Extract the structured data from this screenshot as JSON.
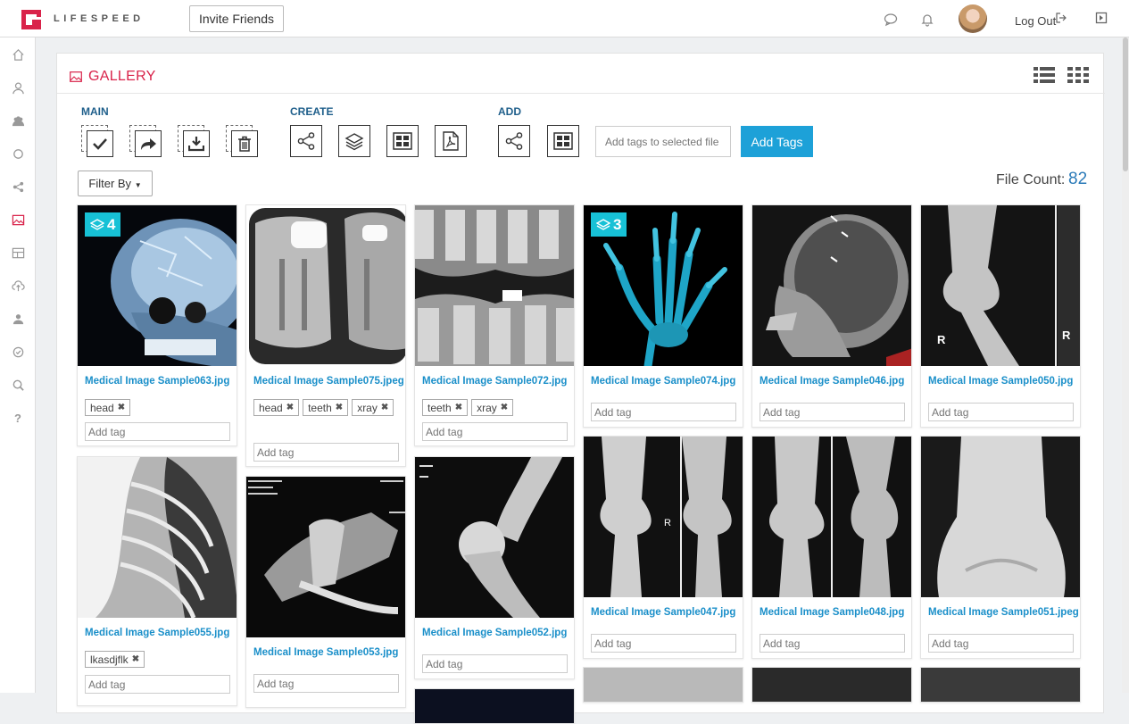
{
  "app": {
    "brand": "LIFESPEED",
    "invite_label": "Invite Friends",
    "logout_label": "Log Out",
    "accent_color": "#d9234a",
    "link_color": "#1a8fc9"
  },
  "gallery": {
    "title": "GALLERY",
    "sections": {
      "main": "MAIN",
      "create": "CREATE",
      "add": "ADD"
    },
    "tag_input_placeholder": "Add tags to selected file",
    "add_tags_label": "Add Tags",
    "filter_label": "Filter By",
    "file_count_label": "File Count:",
    "file_count": "82",
    "add_tag_placeholder": "Add tag"
  },
  "cards": [
    {
      "name": "Medical Image Sample063.jpg",
      "badge": "4",
      "tags": [
        "head"
      ]
    },
    {
      "name": "Medical Image Sample075.jpeg",
      "badge": "",
      "tags": [
        "head",
        "teeth",
        "xray"
      ]
    },
    {
      "name": "Medical Image Sample072.jpg",
      "badge": "",
      "tags": [
        "teeth",
        "xray"
      ]
    },
    {
      "name": "Medical Image Sample074.jpg",
      "badge": "3",
      "tags": []
    },
    {
      "name": "Medical Image Sample046.jpg",
      "badge": "",
      "tags": []
    },
    {
      "name": "Medical Image Sample050.jpg",
      "badge": "",
      "tags": []
    },
    {
      "name": "Medical Image Sample055.jpg",
      "badge": "",
      "tags": [
        "lkasdjflk"
      ]
    },
    {
      "name": "Medical Image Sample053.jpg",
      "badge": "",
      "tags": []
    },
    {
      "name": "Medical Image Sample052.jpg",
      "badge": "",
      "tags": []
    },
    {
      "name": "Medical Image Sample047.jpg",
      "badge": "",
      "tags": []
    },
    {
      "name": "Medical Image Sample048.jpg",
      "badge": "",
      "tags": []
    },
    {
      "name": "Medical Image Sample051.jpeg",
      "badge": "",
      "tags": []
    }
  ]
}
